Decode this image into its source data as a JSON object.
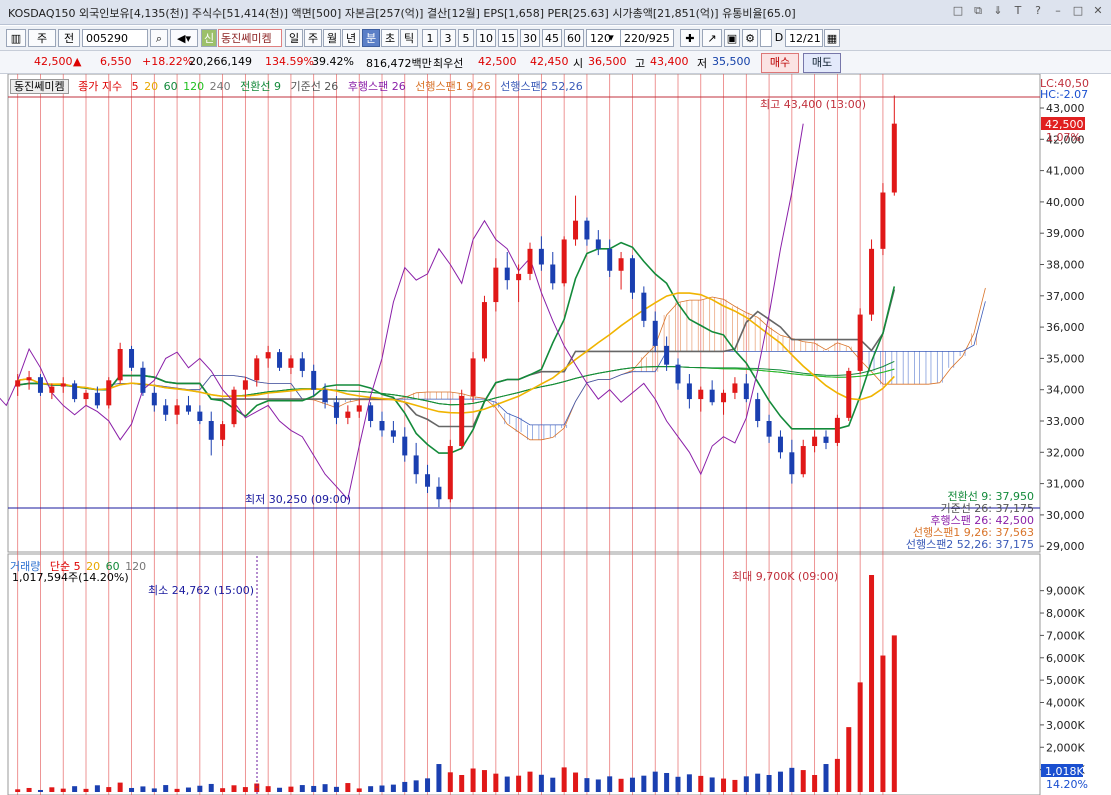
{
  "window": {
    "title": "KOSDAQ150 외국인보유[4,135(천)] 주식수[51,414(천)] 액면[500] 자본금[257(억)] 결산[12월] EPS[1,658] PER[25.63] 시가총액[21,851(억)] 유통비율[65.0]",
    "buttons": [
      "□",
      "⧉",
      "⇓",
      "T",
      "?",
      "–",
      "□",
      "✕"
    ]
  },
  "toolbar": {
    "mode_label": "주",
    "prev_label": "전",
    "code_value": "005290",
    "stock_name": "동진쎄미켐",
    "stock_badge": "신",
    "periods": [
      "일",
      "주",
      "월",
      "년",
      "분",
      "초",
      "틱"
    ],
    "selected_period": "분",
    "intervals": [
      "1",
      "3",
      "5",
      "10",
      "15",
      "30",
      "45",
      "60",
      "120"
    ],
    "interval_value": "120",
    "count_value": "220/925",
    "date_value": "12/21",
    "d_label": "D"
  },
  "pricebar": {
    "price": "42,500",
    "change": "6,550",
    "rate": "+18.22%",
    "volume": "20,266,149",
    "vol_ratio": "134.59%",
    "turnover": "39.42%",
    "amount": "816,472백만",
    "best_ask_label": "최우선",
    "best_ask": "42,500",
    "best_bid": "42,450",
    "open_label": "시",
    "open": "36,500",
    "high_label": "고",
    "high": "43,400",
    "low_label": "저",
    "low": "35,500",
    "buy_label": "매수",
    "sell_label": "매도"
  },
  "legend": {
    "name": "동진쎄미켐",
    "close_label": "종가 지수",
    "ma": [
      "5",
      "20",
      "60",
      "120",
      "240"
    ],
    "ichimoku": [
      "전환선 9",
      "기준선 26",
      "후행스팬 26",
      "선행스팬1 9,26",
      "선행스팬2 52,26"
    ],
    "lc": "LC:40,50",
    "hc": "HC:-2.07"
  },
  "price_panel": {
    "max_label": "최고 43,400 (13:00)",
    "min_label": "최저 30,250 (09:00)",
    "current_tag": "42,500",
    "current_pct": "1.07%",
    "y_ticks": [
      "43,000",
      "42,000",
      "41,000",
      "40,000",
      "39,000",
      "38,000",
      "37,000",
      "36,000",
      "35,000",
      "34,000",
      "33,000",
      "32,000",
      "31,000",
      "30,000",
      "29,000"
    ],
    "info": [
      "전환선 9: 37,950",
      "기준선 26: 37,175",
      "후행스팬 26: 42,500",
      "선행스팬1 9,26: 37,563",
      "선행스팬2 52,26: 37,175"
    ]
  },
  "volume_panel": {
    "legend_title": "거래량",
    "legend_ma": [
      "단순 5",
      "20",
      "60",
      "120"
    ],
    "current_volume": "1,017,594주(14.20%)",
    "min_label": "최소 24,762 (15:00)",
    "max_label": "최대 9,700K (09:00)",
    "y_ticks": [
      "9,000K",
      "8,000K",
      "7,000K",
      "6,000K",
      "5,000K",
      "4,000K",
      "3,000K",
      "2,000K",
      "1,000K"
    ],
    "current_tag": "1,018K",
    "current_pct": "14.20%"
  },
  "chart_data": {
    "type": "candlestick",
    "ylim": [
      29000,
      43500
    ],
    "candles": [
      [
        34100,
        34500,
        33800,
        34300
      ],
      [
        34300,
        34600,
        34000,
        34400
      ],
      [
        34400,
        34500,
        33800,
        33900
      ],
      [
        33900,
        34200,
        33700,
        34100
      ],
      [
        34100,
        34400,
        33900,
        34200
      ],
      [
        34200,
        34300,
        33600,
        33700
      ],
      [
        33700,
        34000,
        33500,
        33900
      ],
      [
        33900,
        34100,
        33400,
        33500
      ],
      [
        33500,
        34400,
        33400,
        34300
      ],
      [
        34300,
        35500,
        34200,
        35300
      ],
      [
        35300,
        35400,
        34600,
        34700
      ],
      [
        34700,
        34900,
        33800,
        33900
      ],
      [
        33900,
        34100,
        33300,
        33500
      ],
      [
        33500,
        33700,
        33000,
        33200
      ],
      [
        33200,
        33700,
        32900,
        33500
      ],
      [
        33500,
        33800,
        33200,
        33300
      ],
      [
        33300,
        33500,
        32900,
        33000
      ],
      [
        33000,
        33300,
        31900,
        32400
      ],
      [
        32400,
        33000,
        32200,
        32900
      ],
      [
        32900,
        34100,
        32800,
        34000
      ],
      [
        34000,
        34400,
        33700,
        34300
      ],
      [
        34300,
        35100,
        34100,
        35000
      ],
      [
        35000,
        35400,
        34700,
        35200
      ],
      [
        35200,
        35300,
        34600,
        34700
      ],
      [
        34700,
        35100,
        34500,
        35000
      ],
      [
        35000,
        35200,
        34400,
        34600
      ],
      [
        34600,
        34800,
        33800,
        34000
      ],
      [
        34000,
        34200,
        33400,
        33600
      ],
      [
        33600,
        33800,
        32900,
        33100
      ],
      [
        33100,
        33500,
        32900,
        33300
      ],
      [
        33300,
        33700,
        33100,
        33500
      ],
      [
        33500,
        33600,
        32800,
        33000
      ],
      [
        33000,
        33300,
        32500,
        32700
      ],
      [
        32700,
        33000,
        32300,
        32500
      ],
      [
        32500,
        32800,
        31700,
        31900
      ],
      [
        31900,
        32300,
        31000,
        31300
      ],
      [
        31300,
        31600,
        30700,
        30900
      ],
      [
        30900,
        31200,
        30250,
        30500
      ],
      [
        30500,
        32400,
        30400,
        32200
      ],
      [
        32200,
        34000,
        32100,
        33800
      ],
      [
        33800,
        35200,
        33600,
        35000
      ],
      [
        35000,
        37000,
        34900,
        36800
      ],
      [
        36800,
        38200,
        36500,
        37900
      ],
      [
        37900,
        38400,
        37200,
        37500
      ],
      [
        37500,
        38000,
        36800,
        37700
      ],
      [
        37700,
        38700,
        37500,
        38500
      ],
      [
        38500,
        38900,
        37800,
        38000
      ],
      [
        38000,
        38400,
        37200,
        37400
      ],
      [
        37400,
        38900,
        37300,
        38800
      ],
      [
        38800,
        40200,
        38600,
        39400
      ],
      [
        39400,
        39500,
        38600,
        38800
      ],
      [
        38800,
        39100,
        38300,
        38500
      ],
      [
        38500,
        38800,
        37600,
        37800
      ],
      [
        37800,
        38400,
        37200,
        38200
      ],
      [
        38200,
        38300,
        36900,
        37100
      ],
      [
        37100,
        37300,
        36000,
        36200
      ],
      [
        36200,
        36500,
        35200,
        35400
      ],
      [
        35400,
        35700,
        34600,
        34800
      ],
      [
        34800,
        35000,
        34000,
        34200
      ],
      [
        34200,
        34500,
        33400,
        33700
      ],
      [
        33700,
        34100,
        33300,
        34000
      ],
      [
        34000,
        34300,
        33500,
        33600
      ],
      [
        33600,
        34000,
        33200,
        33900
      ],
      [
        33900,
        34400,
        33700,
        34200
      ],
      [
        34200,
        34500,
        33600,
        33700
      ],
      [
        33700,
        33900,
        32800,
        33000
      ],
      [
        33000,
        33200,
        32300,
        32500
      ],
      [
        32500,
        32700,
        31800,
        32000
      ],
      [
        32000,
        32400,
        31000,
        31300
      ],
      [
        31300,
        32400,
        31200,
        32200
      ],
      [
        32200,
        32700,
        32000,
        32500
      ],
      [
        32500,
        32700,
        32100,
        32300
      ],
      [
        32300,
        33200,
        32200,
        33100
      ],
      [
        33100,
        34700,
        33000,
        34600
      ],
      [
        34600,
        36600,
        34500,
        36400
      ],
      [
        36400,
        38800,
        36200,
        38500
      ],
      [
        38500,
        40600,
        38300,
        40300
      ],
      [
        40300,
        43400,
        40200,
        42500
      ]
    ],
    "volumes": [
      120,
      180,
      90,
      210,
      150,
      260,
      140,
      300,
      220,
      420,
      180,
      250,
      160,
      310,
      140,
      200,
      280,
      360,
      170,
      300,
      220,
      380,
      260,
      190,
      240,
      310,
      270,
      350,
      230,
      400,
      160,
      260,
      290,
      330,
      450,
      520,
      610,
      1250,
      880,
      760,
      1050,
      980,
      820,
      690,
      730,
      910,
      770,
      640,
      1100,
      870,
      620,
      560,
      700,
      590,
      640,
      730,
      910,
      850,
      680,
      790,
      720,
      650,
      600,
      540,
      700,
      820,
      760,
      910,
      1080,
      980,
      760,
      1250,
      1480,
      2900,
      4900,
      9700,
      6100,
      7000
    ]
  }
}
